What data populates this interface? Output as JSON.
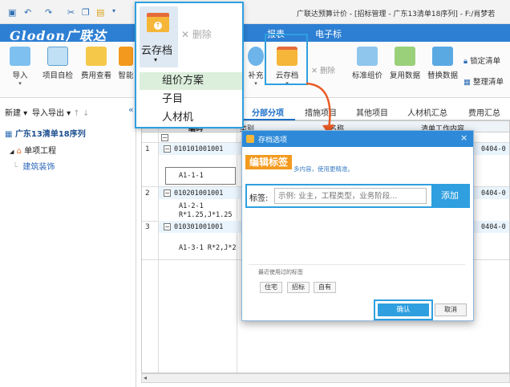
{
  "window": {
    "title": "广联达预算计价 - [招标管理 - 广东13清单18序列] - F:/肖梦若"
  },
  "brand": {
    "logo": "Glodon广联达",
    "color": "#2d7fd3"
  },
  "menu_tabs": [
    "报表",
    "电子标"
  ],
  "ribbon": {
    "import": "导入",
    "self_check": "项目自检",
    "fee_view": "费用查看",
    "smart": "智能",
    "supplement": "补充",
    "cloud_archive": "云存档",
    "delete": "删除",
    "standard_pricing": "标准组价",
    "reuse_data": "复用数据",
    "replace_data": "替换数据",
    "lock_list": "锁定清单",
    "organize_list": "整理清单"
  },
  "left_toolbar": {
    "new": "新建",
    "import_export": "导入导出"
  },
  "tree": {
    "root": "广东13清单18序列",
    "child": "单项工程",
    "leaf": "建筑装饰"
  },
  "tabs": [
    "分部分项",
    "措施项目",
    "其他项目",
    "人材机汇总",
    "费用汇总"
  ],
  "grid": {
    "header_code": "编码",
    "header_partial_1": "类别",
    "header_partial_2": "名称",
    "header_partial_3": "清单工作内容",
    "rows": [
      {
        "num": "1",
        "code": "010101001001",
        "sub": [
          "A1-1-1"
        ]
      },
      {
        "num": "2",
        "code": "010201001001",
        "sub": [
          "A1-2-1",
          "R*1.25,J*1.25"
        ]
      },
      {
        "num": "3",
        "code": "010301001001",
        "sub": [
          "A1-3-1 R*2,J*2"
        ]
      }
    ],
    "right_col_value": "0404-0"
  },
  "callout": {
    "button_label": "云存档",
    "delete_label": "删除",
    "items": [
      "组价方案",
      "子目",
      "人材机"
    ]
  },
  "dialog": {
    "title": "存档选项",
    "hint": "多内容，使用更精准。",
    "edit_tag_banner": "编辑标签",
    "tag_label": "标签:",
    "tag_placeholder": "示例: 业主，工程类型，业务阶段...",
    "add_button": "添加",
    "recent_label": "最近使用过的标签",
    "recent_tags": [
      "住宅",
      "招标",
      "自有"
    ],
    "confirm": "确认",
    "cancel": "取消",
    "close": "×"
  },
  "colors": {
    "accent": "#2f9fe0",
    "orange": "#f39a1e",
    "dialog_title": "#2e8ad8",
    "arrow": "#e85a24"
  }
}
